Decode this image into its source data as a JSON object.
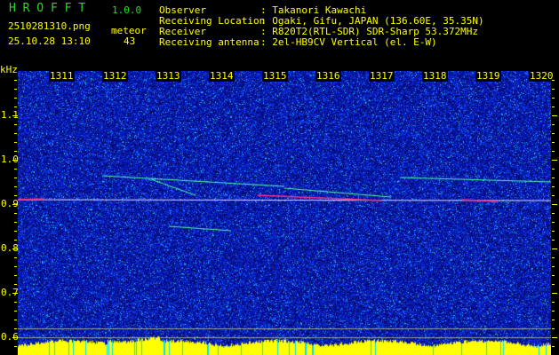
{
  "app": {
    "name": "H R O F F T",
    "version": "1.0.0"
  },
  "file": {
    "filename": "2510281310.png",
    "datetime": "25.10.28 13:10"
  },
  "meteor": {
    "label": "meteor",
    "count": "43"
  },
  "info": [
    {
      "label": "Observer",
      "value": ": Takanori Kawachi"
    },
    {
      "label": "Receiving Location",
      "value": ": Ogaki, Gifu, JAPAN (136.60E, 35.35N)"
    },
    {
      "label": "Receiver",
      "value": ": R820T2(RTL-SDR) SDR-Sharp 53.372MHz"
    },
    {
      "label": "Receiving antenna",
      "value": ": 2el-HB9CV Vertical (el. E-W)"
    }
  ],
  "axis": {
    "unit": "kHz",
    "x_ticks": [
      "1311",
      "1312",
      "1313",
      "1314",
      "1315",
      "1316",
      "1317",
      "1318",
      "1319",
      "1320"
    ],
    "y_ticks": [
      "1.1",
      "1.0",
      "0.9",
      "0.8",
      "0.7",
      "0.6"
    ]
  },
  "colors": {
    "text": "#ffff00",
    "title": "#22dd22",
    "background": "#000000",
    "noise": "#0a1ec8",
    "signal": "#ff3080",
    "level": "#ffff00"
  }
}
